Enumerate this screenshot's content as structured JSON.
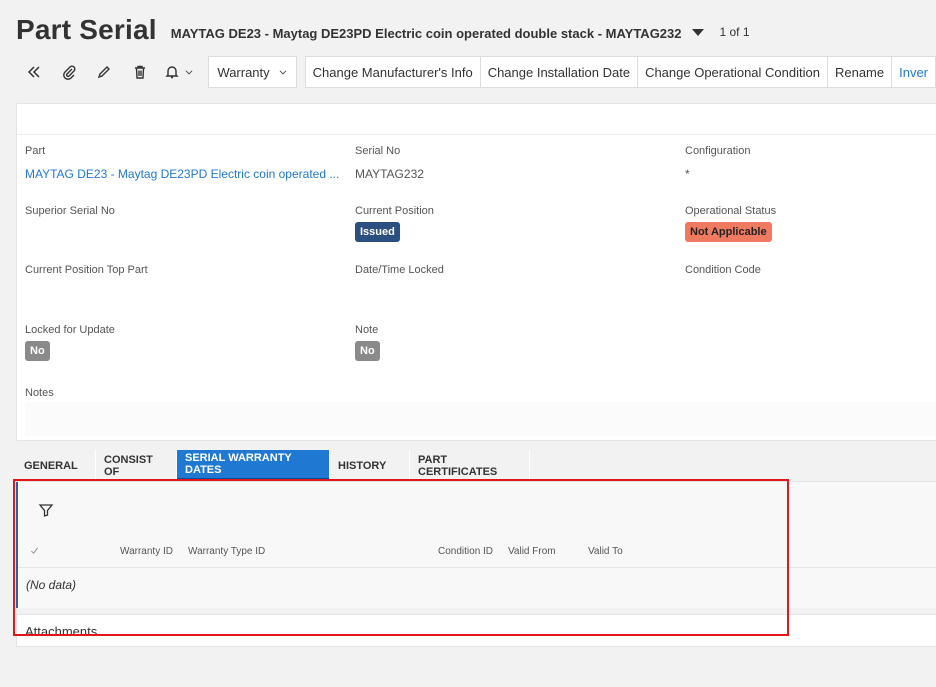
{
  "header": {
    "title": "Part Serial",
    "record": "MAYTAG DE23 - Maytag DE23PD Electric coin operated double stack - MAYTAG232",
    "count": "1 of 1"
  },
  "toolbar": {
    "dropdown": "Warranty",
    "buttons": [
      "Change Manufacturer's Info",
      "Change Installation Date",
      "Change Operational Condition",
      "Rename",
      "Inver"
    ]
  },
  "fields": {
    "part": {
      "label": "Part",
      "value": "MAYTAG DE23 - Maytag DE23PD Electric coin operated ..."
    },
    "serial_no": {
      "label": "Serial No",
      "value": "MAYTAG232"
    },
    "configuration": {
      "label": "Configuration",
      "value": "*"
    },
    "superior_serial_no": {
      "label": "Superior Serial No",
      "value": ""
    },
    "current_position": {
      "label": "Current Position",
      "value": "Issued"
    },
    "operational_status": {
      "label": "Operational Status",
      "value": "Not Applicable"
    },
    "current_position_top_part": {
      "label": "Current Position Top Part",
      "value": ""
    },
    "date_time_locked": {
      "label": "Date/Time Locked",
      "value": ""
    },
    "condition_code": {
      "label": "Condition Code",
      "value": ""
    },
    "locked_for_update": {
      "label": "Locked for Update",
      "value": "No"
    },
    "note": {
      "label": "Note",
      "value": "No"
    },
    "notes": {
      "label": "Notes",
      "value": ""
    }
  },
  "tabs": [
    {
      "label": "GENERAL",
      "active": false
    },
    {
      "label": "CONSIST OF",
      "active": false
    },
    {
      "label": "SERIAL WARRANTY DATES",
      "active": true
    },
    {
      "label": "HISTORY",
      "active": false
    },
    {
      "label": "PART CERTIFICATES",
      "active": false
    }
  ],
  "warranty_table": {
    "columns": [
      "Warranty ID",
      "Warranty Type ID",
      "Condition ID",
      "Valid From",
      "Valid To"
    ],
    "empty_text": "(No data)"
  },
  "attachments": {
    "title": "Attachments"
  },
  "colors": {
    "accent": "#1f78d1",
    "issued_badge": "#2b4f80",
    "not_applicable_badge": "#ef7a60",
    "highlight_box": "#e3151a"
  }
}
